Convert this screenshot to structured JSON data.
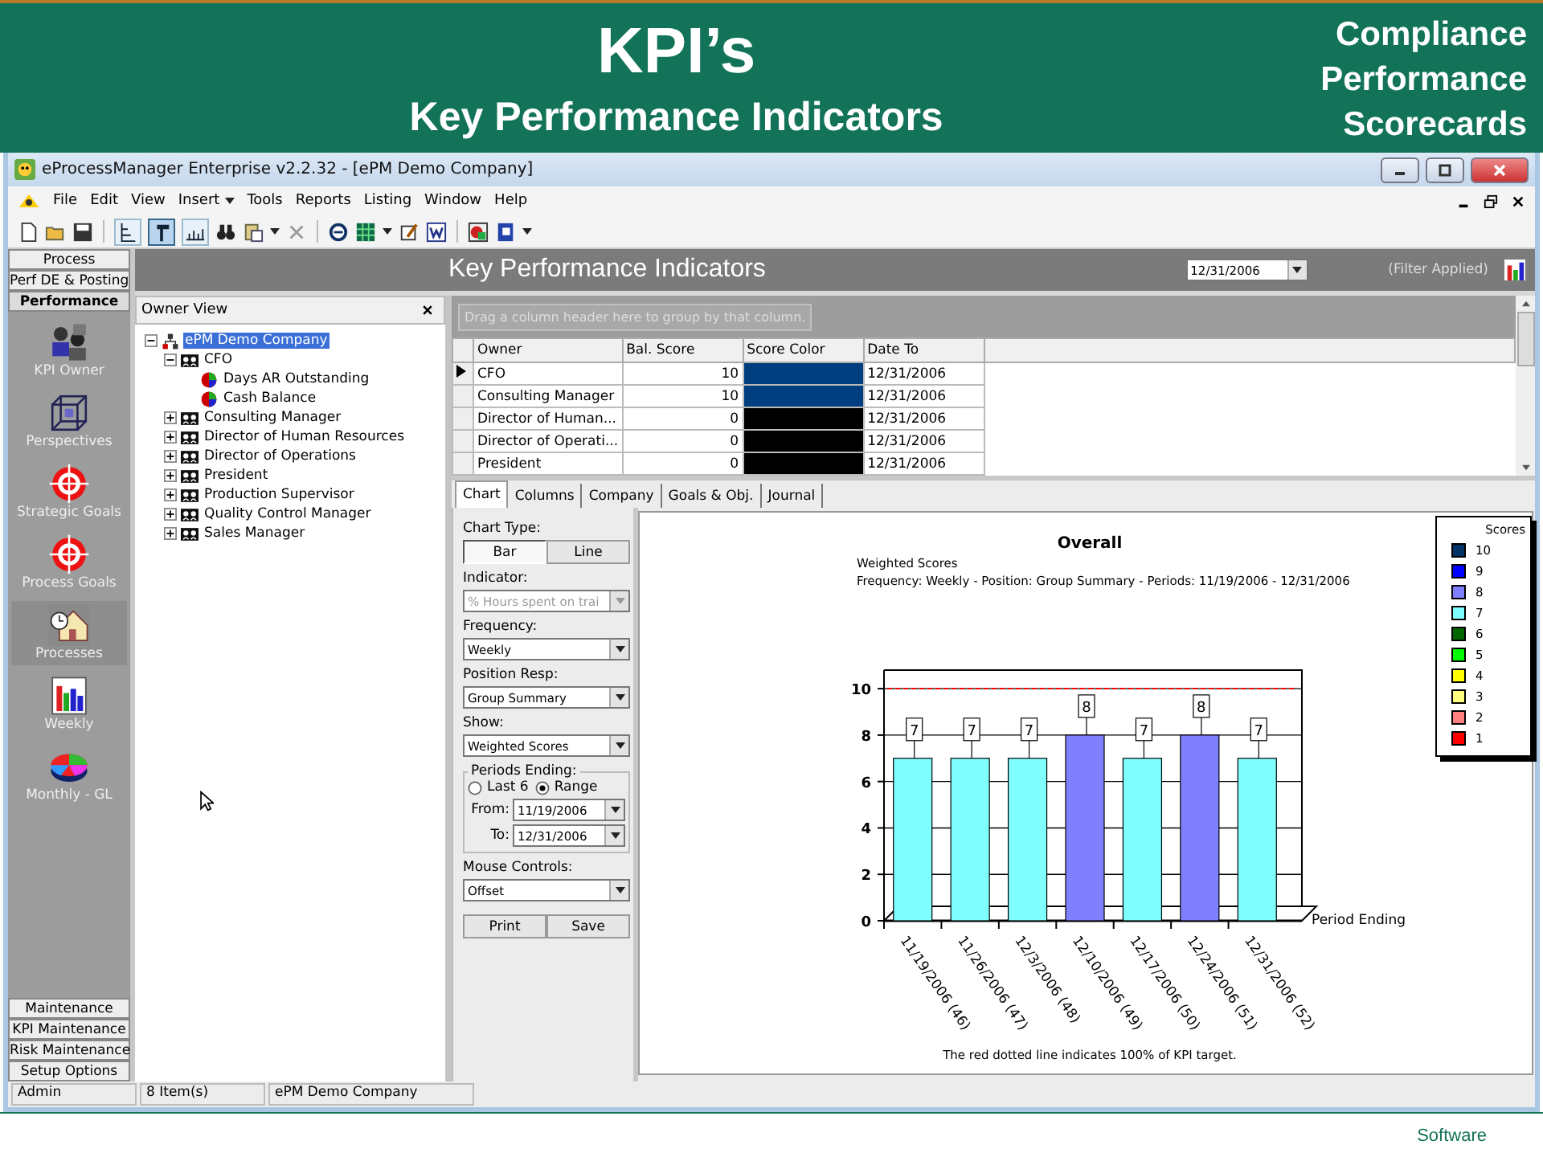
{
  "slide": {
    "title": "KPI’s",
    "subtitle": "Key Performance Indicators",
    "corner_lines": [
      "Compliance",
      "Performance",
      "Scorecards"
    ],
    "footer": "Software"
  },
  "window": {
    "title": "eProcessManager Enterprise v2.2.32 - [ePM Demo Company]"
  },
  "menu": [
    {
      "label": "File",
      "dropdown": false
    },
    {
      "label": "Edit",
      "dropdown": false
    },
    {
      "label": "View",
      "dropdown": false
    },
    {
      "label": "Insert",
      "dropdown": true
    },
    {
      "label": "Tools",
      "dropdown": false
    },
    {
      "label": "Reports",
      "dropdown": false
    },
    {
      "label": "Listing",
      "dropdown": false
    },
    {
      "label": "Window",
      "dropdown": false
    },
    {
      "label": "Help",
      "dropdown": false
    }
  ],
  "toolbar_toggles": [
    {
      "pressed": false
    },
    {
      "pressed": true
    },
    {
      "pressed": false
    }
  ],
  "nav": {
    "groups": [
      {
        "label": "Process",
        "selected": false
      },
      {
        "label": "Perf DE & Posting",
        "selected": false
      },
      {
        "label": "Performance",
        "selected": true
      }
    ],
    "items": [
      {
        "label": "KPI Owner",
        "selected": false
      },
      {
        "label": "Perspectives",
        "selected": false
      },
      {
        "label": "Strategic Goals",
        "selected": false
      },
      {
        "label": "Process Goals",
        "selected": false
      },
      {
        "label": "Processes",
        "selected": true
      },
      {
        "label": "Weekly",
        "selected": false
      },
      {
        "label": "Monthly - GL",
        "selected": false
      }
    ],
    "bottom": [
      "Maintenance",
      "KPI Maintenance",
      "Risk Maintenance",
      "Setup Options"
    ]
  },
  "kpi_header": {
    "title": "Key Performance Indicators",
    "date": "12/31/2006",
    "filter_note": "(Filter Applied)"
  },
  "owner_view": {
    "title": "Owner View",
    "tree": [
      {
        "label": "ePM Demo Company",
        "kind": "company",
        "selected": true,
        "expanded": true,
        "children": [
          {
            "label": "CFO",
            "kind": "owner",
            "selected": false,
            "expanded": true,
            "children": [
              {
                "label": "Days AR Outstanding",
                "kind": "kpi",
                "selected": false
              },
              {
                "label": "Cash Balance",
                "kind": "kpi",
                "selected": false
              }
            ]
          },
          {
            "label": "Consulting Manager",
            "kind": "owner",
            "selected": false,
            "expanded": false
          },
          {
            "label": "Director of Human Resources",
            "kind": "owner",
            "selected": false,
            "expanded": false
          },
          {
            "label": "Director of Operations",
            "kind": "owner",
            "selected": false,
            "expanded": false
          },
          {
            "label": "President",
            "kind": "owner",
            "selected": false,
            "expanded": false
          },
          {
            "label": "Production Supervisor",
            "kind": "owner",
            "selected": false,
            "expanded": false
          },
          {
            "label": "Quality Control Manager",
            "kind": "owner",
            "selected": false,
            "expanded": false
          },
          {
            "label": "Sales Manager",
            "kind": "owner",
            "selected": false,
            "expanded": false
          }
        ]
      }
    ]
  },
  "grid": {
    "group_hint": "Drag a column header here to group by that column.",
    "columns": [
      "Owner",
      "Bal. Score",
      "Score Color",
      "Date To"
    ],
    "rows": [
      {
        "owner": "CFO",
        "score": "10",
        "color": "#003f7f",
        "date": "12/31/2006",
        "selected": true
      },
      {
        "owner": "Consulting Manager",
        "score": "10",
        "color": "#003f7f",
        "date": "12/31/2006",
        "selected": false
      },
      {
        "owner": "Director of Human...",
        "score": "0",
        "color": "#000000",
        "date": "12/31/2006",
        "selected": false
      },
      {
        "owner": "Director of Operati...",
        "score": "0",
        "color": "#000000",
        "date": "12/31/2006",
        "selected": false
      },
      {
        "owner": "President",
        "score": "0",
        "color": "#000000",
        "date": "12/31/2006",
        "selected": false
      }
    ]
  },
  "tabs": [
    {
      "label": "Chart",
      "selected": true
    },
    {
      "label": "Columns",
      "selected": false
    },
    {
      "label": "Company",
      "selected": false
    },
    {
      "label": "Goals & Obj.",
      "selected": false
    },
    {
      "label": "Journal",
      "selected": false
    }
  ],
  "controls": {
    "chart_type_label": "Chart Type:",
    "chart_types": [
      {
        "label": "Bar",
        "selected": true
      },
      {
        "label": "Line",
        "selected": false
      }
    ],
    "combos": [
      {
        "label": "Indicator:",
        "value": "% Hours spent on trai",
        "disabled": true
      },
      {
        "label": "Frequency:",
        "value": "Weekly",
        "disabled": false
      },
      {
        "label": "Position Resp:",
        "value": "Group Summary",
        "disabled": false
      },
      {
        "label": "Show:",
        "value": "Weighted Scores",
        "disabled": false
      }
    ],
    "periods": {
      "title": "Periods Ending:",
      "options": [
        {
          "label": "Last 6",
          "selected": false
        },
        {
          "label": "Range",
          "selected": true
        }
      ],
      "from_label": "From:",
      "from": "11/19/2006",
      "to_label": "To:",
      "to": "12/31/2006"
    },
    "mouse_label": "Mouse Controls:",
    "mouse_value": "Offset",
    "buttons": [
      "Print",
      "Save"
    ]
  },
  "chart": {
    "subtitle_lines": [
      "Frequency: Weekly - Position: Group Summary - Periods: 11/19/2006 - 12/31/2006"
    ],
    "footnote": "The red dotted line indicates 100% of KPI target.",
    "chart_data": {
      "type": "bar",
      "title": "Overall",
      "xlabel": "Period Ending",
      "categories": [
        "11/19/2006 (46)",
        "11/26/2006 (47)",
        "12/3/2006 (48)",
        "12/10/2006 (49)",
        "12/17/2006 (50)",
        "12/24/2006 (51)",
        "12/31/2006 (52)"
      ],
      "series": [
        {
          "name": "Weighted Scores",
          "values": [
            7,
            7,
            7,
            8,
            7,
            8,
            7
          ]
        }
      ],
      "ylim": [
        0,
        10.8
      ],
      "grid": true,
      "yticks": [
        0,
        2,
        4,
        6,
        8,
        10
      ],
      "data_labels": true,
      "ref_lines": [
        {
          "axis": "y",
          "value": 10,
          "color": "#ff0000"
        }
      ]
    }
  },
  "legend": {
    "title": "Scores",
    "items": [
      {
        "label": "10",
        "color": "#003366"
      },
      {
        "label": "9",
        "color": "#0000ff"
      },
      {
        "label": "8",
        "color": "#8080ff"
      },
      {
        "label": "7",
        "color": "#80ffff"
      },
      {
        "label": "6",
        "color": "#006600"
      },
      {
        "label": "5",
        "color": "#00ff00"
      },
      {
        "label": "4",
        "color": "#ffff00"
      },
      {
        "label": "3",
        "color": "#ffff80"
      },
      {
        "label": "2",
        "color": "#ff8080"
      },
      {
        "label": "1",
        "color": "#ff0000"
      }
    ]
  },
  "status_bar": [
    "Admin",
    "8 Item(s)",
    "ePM Demo Company"
  ]
}
